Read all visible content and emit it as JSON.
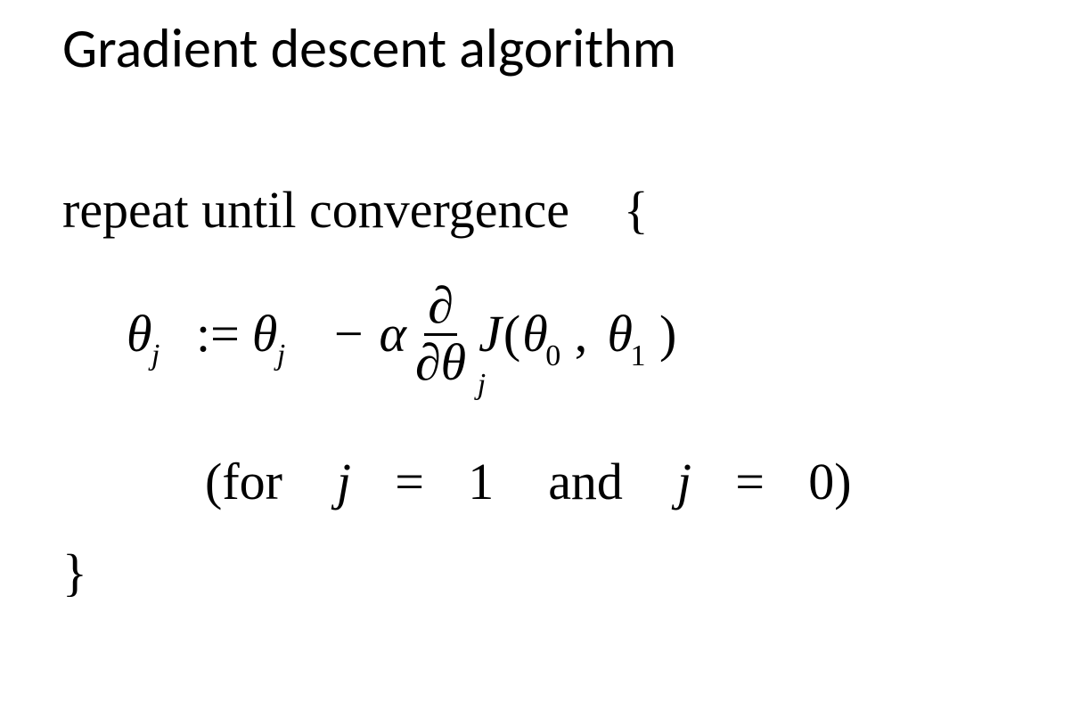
{
  "title": "Gradient descent algorithm",
  "algo": {
    "repeat_text": "repeat until convergence",
    "open_brace": "{",
    "close_brace": "}",
    "equation": {
      "theta": "θ",
      "subscript_j": "j",
      "assign": ":=",
      "minus": "−",
      "alpha": "α",
      "partial": "∂",
      "cost_fn": "J",
      "lparen": "(",
      "rparen": ")",
      "comma": ",",
      "subscript_0": "0",
      "subscript_1": "1"
    },
    "for_line": {
      "lparen": "(",
      "for_word": "for",
      "var_j": "j",
      "eq": "=",
      "val1": "1",
      "and_word": "and",
      "val0": "0",
      "rparen": ")"
    }
  }
}
